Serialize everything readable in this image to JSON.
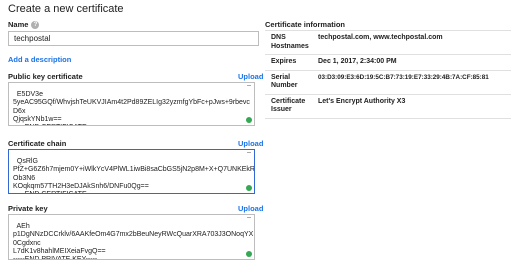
{
  "page": {
    "title": "Create a new certificate"
  },
  "name": {
    "label": "Name",
    "value": "techpostal"
  },
  "add_description": "Add a description",
  "public_key": {
    "label": "Public key certificate",
    "upload": "Upload",
    "text": "E5DV3e\n5yeAC95GQf/WhvjshTeUKVJIAm4t2Pd89ZELIg32yzmfgYbFc+pJws+9rbevc\nD6x\nQjqskYNb1w==\n-----END CERTIFICATE-----"
  },
  "chain": {
    "label": "Certificate chain",
    "upload": "Upload",
    "text": "QsRlG\nPfZ+G6Z6h7mjem0Y+iWlkYcV4PlWL1iwBi8saCbGS5jN2p8M+X+Q7UNKEkR\nOb3N6\nKOqkqm57TH2H3eDJAkSnh6/DNFu0Qg==\n-----END CERTIFICATE-----"
  },
  "private_key": {
    "label": "Private key",
    "upload": "Upload",
    "text": "AEh\np1DgNNzDCCrklv/6AAKfeOm4G7mx2bBeuNeyRWcQuarXRA703J3ONoqYX\n0Cgdxnc\nL7dK1v8hahlMEIXeiaFvgQ==\n-----END PRIVATE KEY-----"
  },
  "info": {
    "title": "Certificate information",
    "rows": [
      {
        "key": "DNS Hostnames",
        "value": "techpostal.com, www.techpostal.com"
      },
      {
        "key": "Expires",
        "value": "Dec 1, 2017, 2:34:00 PM"
      },
      {
        "key": "Serial Number",
        "value": "03:D3:09:E3:6D:19:5C:B7:73:19:E7:33:29:4B:7A:CF:85:81"
      },
      {
        "key": "Certificate Issuer",
        "value": "Let's Encrypt Authority X3"
      }
    ]
  }
}
